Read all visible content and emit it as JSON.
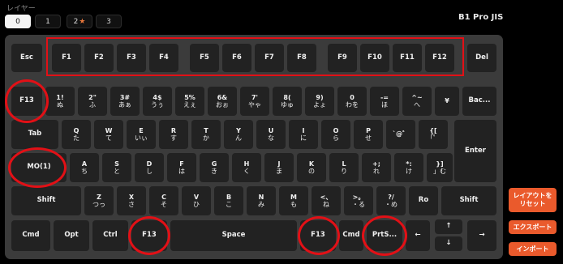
{
  "layer_label": "レイヤー",
  "layer_tabs": [
    {
      "label": "0",
      "active": true,
      "starred": false
    },
    {
      "label": "1",
      "active": false,
      "starred": false
    },
    {
      "label": "2",
      "active": false,
      "starred": true
    },
    {
      "label": "3",
      "active": false,
      "starred": false
    }
  ],
  "star_glyph": "★",
  "model_name": "B1 Pro JIS",
  "highlight_color": "#e21016",
  "accent_color": "#ea5a2c",
  "keys": {
    "esc": "Esc",
    "f1": "F1",
    "f2": "F2",
    "f3": "F3",
    "f4": "F4",
    "f5": "F5",
    "f6": "F6",
    "f7": "F7",
    "f8": "F8",
    "f9": "F9",
    "f10": "F10",
    "f11": "F11",
    "f12": "F12",
    "del": "Del",
    "f13_left": "F13",
    "k1": {
      "a": "1!",
      "b": "ぬ"
    },
    "k2": {
      "a": "2\"",
      "b": "ふ"
    },
    "k3": {
      "a": "3#",
      "b": "あぁ"
    },
    "k4": {
      "a": "4$",
      "b": "うぅ"
    },
    "k5": {
      "a": "5%",
      "b": "えぇ"
    },
    "k6": {
      "a": "6&",
      "b": "おぉ"
    },
    "k7": {
      "a": "7'",
      "b": "やゃ"
    },
    "k8": {
      "a": "8(",
      "b": "ゆゅ"
    },
    "k9": {
      "a": "9)",
      "b": "よょ"
    },
    "k0": {
      "a": "0",
      "b": "わを"
    },
    "kminus": {
      "a": "-=",
      "b": "ほ"
    },
    "kcaret": {
      "a": "^~",
      "b": "へ"
    },
    "kyen": {
      "a": "¥",
      "b": ""
    },
    "backspace": "Bac...",
    "tab": "Tab",
    "q": {
      "a": "Q",
      "b": "た"
    },
    "w": {
      "a": "W",
      "b": "て"
    },
    "e": {
      "a": "E",
      "b": "いぃ"
    },
    "r": {
      "a": "R",
      "b": "す"
    },
    "t": {
      "a": "T",
      "b": "か"
    },
    "y": {
      "a": "Y",
      "b": "ん"
    },
    "u": {
      "a": "U",
      "b": "な"
    },
    "i": {
      "a": "I",
      "b": "に"
    },
    "o": {
      "a": "O",
      "b": "ら"
    },
    "p": {
      "a": "P",
      "b": "せ"
    },
    "kat": {
      "a": "`@゛",
      "b": ""
    },
    "kbracket": {
      "a": "{[",
      "b": "「゜"
    },
    "enter": "Enter",
    "mo1": "MO(1)",
    "a": {
      "a": "A",
      "b": "ち"
    },
    "s": {
      "a": "S",
      "b": "と"
    },
    "d": {
      "a": "D",
      "b": "し"
    },
    "f": {
      "a": "F",
      "b": "は"
    },
    "g": {
      "a": "G",
      "b": "き"
    },
    "h": {
      "a": "H",
      "b": "く"
    },
    "j": {
      "a": "J",
      "b": "ま"
    },
    "k": {
      "a": "K",
      "b": "の"
    },
    "l": {
      "a": "L",
      "b": "り"
    },
    "ksemi": {
      "a": "+;",
      "b": "れ"
    },
    "kcolon": {
      "a": "*:",
      "b": "け"
    },
    "kclose": {
      "a": "}]",
      "b": "」む"
    },
    "shift_left": "Shift",
    "z": {
      "a": "Z",
      "b": "つっ"
    },
    "x": {
      "a": "X",
      "b": "さ"
    },
    "c": {
      "a": "C",
      "b": "そ"
    },
    "v": {
      "a": "V",
      "b": "ひ"
    },
    "b": {
      "a": "B",
      "b": "こ"
    },
    "n": {
      "a": "N",
      "b": "み"
    },
    "m": {
      "a": "M",
      "b": "も"
    },
    "kcomma": {
      "a": "<、",
      "b": "ね"
    },
    "kperiod": {
      "a": ">。",
      "b": "・る"
    },
    "kslash": {
      "a": "?/",
      "b": "・め"
    },
    "ro": "Ro",
    "shift_right": "Shift",
    "cmd_left": "Cmd",
    "opt": "Opt",
    "ctrl": "Ctrl",
    "f13_mid": "F13",
    "space": "Space",
    "f13_right": "F13",
    "cmd_right": "Cmd",
    "prtsc": "PrtS...",
    "left": "←",
    "up": "↑",
    "down": "↓",
    "right": "→"
  },
  "buttons": {
    "reset": "レイアウトを\nリセット",
    "export": "エクスポート",
    "import": "インポート"
  }
}
